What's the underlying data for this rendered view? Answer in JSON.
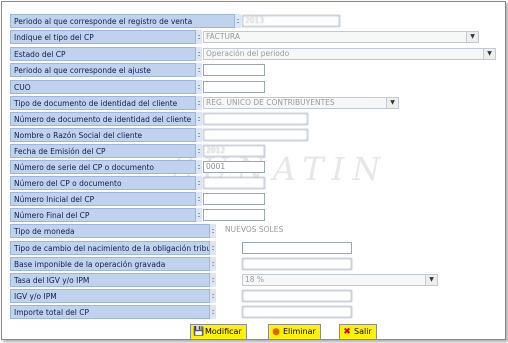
{
  "form": {
    "fields": [
      {
        "label": "Periodo al que corresponde el registro de venta",
        "value": "2013",
        "kind": "input",
        "blurred": true
      },
      {
        "label": "Indique el tipo del CP",
        "value": "FACTURA",
        "kind": "select"
      },
      {
        "label": "Estado del CP",
        "value": "Operación del periodo",
        "kind": "select"
      },
      {
        "label": "Periodo al que corresponde el ajuste",
        "value": "",
        "kind": "input"
      },
      {
        "label": "CUO",
        "value": "",
        "kind": "input"
      },
      {
        "label": "Tipo de documento de identidad del cliente",
        "value": "REG. UNICO DE CONTRIBUYENTES",
        "kind": "select"
      },
      {
        "label": "Número de documento de identidad del cliente",
        "value": "",
        "kind": "input",
        "blurred": true
      },
      {
        "label": "Nombre o Razón Social del cliente",
        "value": "",
        "kind": "input",
        "blurred": true
      },
      {
        "label": "Fecha de Emisión del CP",
        "value": "2012",
        "kind": "input",
        "blurred": true
      },
      {
        "label": "Número de serie del CP o documento",
        "value": "0001",
        "kind": "input"
      },
      {
        "label": "Número del CP o documento",
        "value": "",
        "kind": "input",
        "blurred": true
      },
      {
        "label": "Número Inicial del CP",
        "value": "",
        "kind": "input"
      },
      {
        "label": "Número Final del CP",
        "value": "",
        "kind": "input"
      },
      {
        "label": "Tipo de moneda",
        "value": "NUEVOS SOLES",
        "kind": "readonly"
      },
      {
        "label": "Tipo de cambio del nacimiento de la obligación tributaria",
        "value": "",
        "kind": "input"
      },
      {
        "label": "Base imponible de la operación gravada",
        "value": "",
        "kind": "input",
        "blurred": true
      },
      {
        "label": "Tasa del IGV y/o IPM",
        "value": "18 %",
        "kind": "select"
      },
      {
        "label": "IGV y/o IPM",
        "value": "",
        "kind": "input",
        "blurred": true
      },
      {
        "label": "Importe total del CP",
        "value": "",
        "kind": "input",
        "blurred": true
      }
    ],
    "colon": ":"
  },
  "watermark": "SUNATIN",
  "buttons": {
    "modify": "Modificar",
    "delete": "Eliminar",
    "exit": "Salir"
  },
  "icons": {
    "modify": "save-icon",
    "delete": "delete-icon",
    "exit": "close-x-icon"
  },
  "colors": {
    "label_bg": "#bfd3ee",
    "button_bg": "#fff200"
  }
}
